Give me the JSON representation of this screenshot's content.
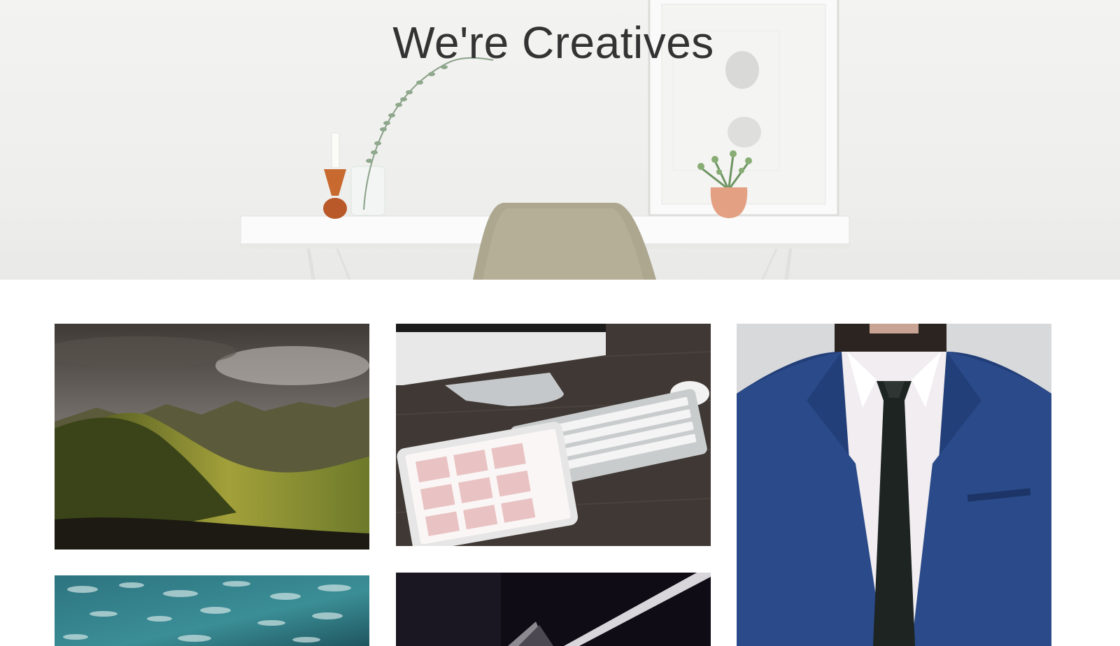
{
  "hero": {
    "title": "We're Creatives",
    "image": "minimal-desk-workspace"
  },
  "gallery": {
    "items": [
      {
        "image": "mountain-valley-landscape"
      },
      {
        "image": "desk-keyboard-tablet-calendar"
      },
      {
        "image": "man-in-blue-suit"
      },
      {
        "image": "aerial-ocean-clouds"
      },
      {
        "image": "dark-abstract-light"
      }
    ]
  },
  "colors": {
    "title": "#333333",
    "hero_bg": "#efefed",
    "suit": "#23407a",
    "desk": "#3d3632",
    "valley": "#8a8c2a"
  }
}
